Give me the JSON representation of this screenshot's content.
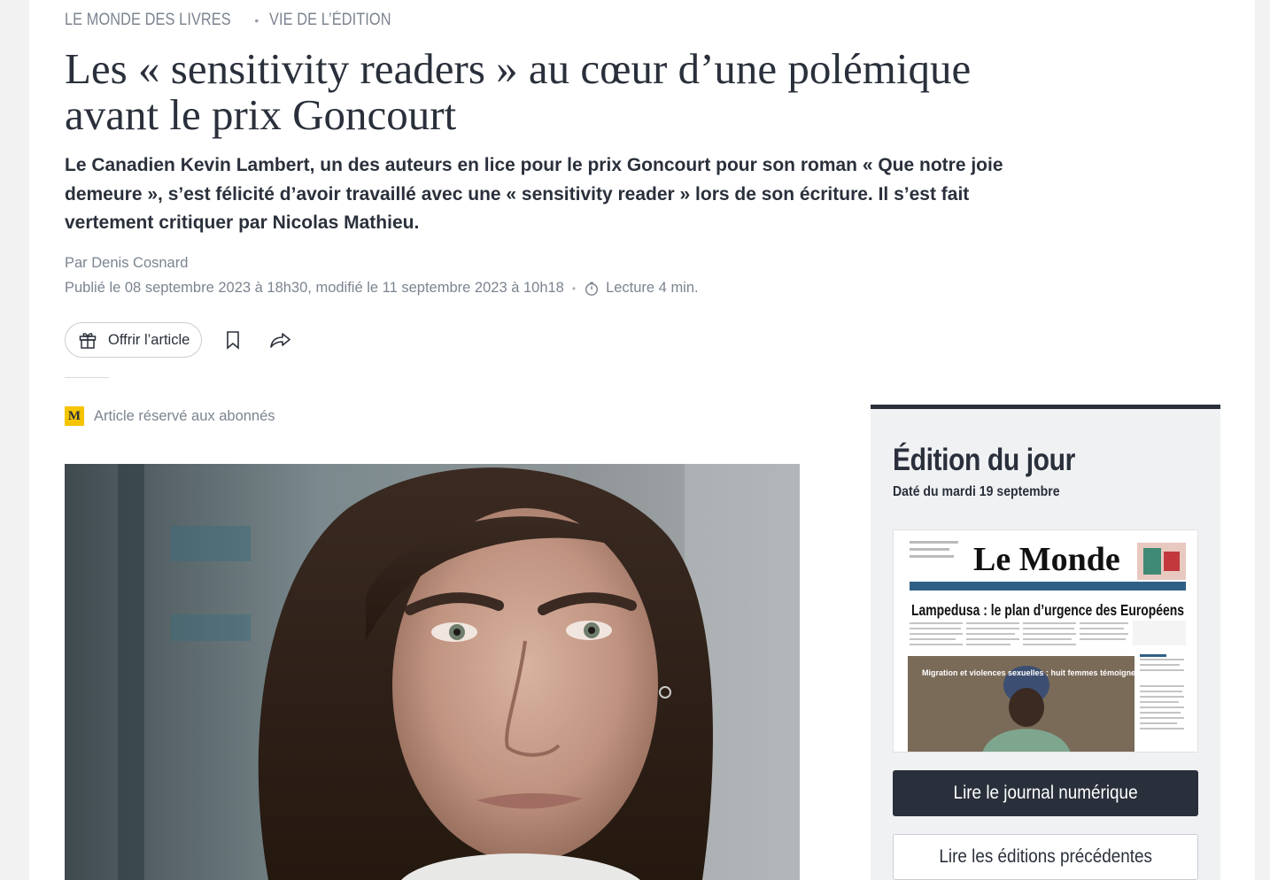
{
  "breadcrumb": {
    "section": "LE MONDE DES LIVRES",
    "subsection": "VIE DE L’ÉDITION"
  },
  "article": {
    "title": "Les « sensitivity readers » au cœur d’une polémique avant le prix Goncourt",
    "standfirst": "Le Canadien Kevin Lambert, un des auteurs en lice pour le prix Goncourt pour son roman « Que notre joie demeure », s’est félicité d’avoir travaillé avec une « sensitivity reader » lors de son écriture. Il s’est fait vertement critiquer par Nicolas Mathieu.",
    "author": "Par Denis Cosnard",
    "published": "Publié le 08 septembre 2023 à 18h30, modifié le 11 septembre 2023 à 10h18",
    "reading_time": "Lecture 4 min.",
    "premium_label": "Article réservé aux abonnés",
    "premium_badge": "M"
  },
  "actions": {
    "offer_label": "Offrir l’article",
    "icons": [
      "gift-icon",
      "bookmark-icon",
      "share-icon",
      "timer-icon"
    ]
  },
  "sidebar": {
    "title": "Édition du jour",
    "date": "Daté du mardi 19 septembre",
    "read_button": "Lire le journal numérique",
    "previous_button": "Lire les éditions précédentes",
    "cover": {
      "masthead": "Le Monde",
      "headline": "Lampedusa : le plan d’urgence des Européens",
      "photo_caption": "Migration et violences sexuelles : huit femmes témoignent"
    }
  },
  "colors": {
    "text": "#2a303b",
    "muted": "#7b8490",
    "premium": "#f5c400",
    "dark_button": "#2a303b"
  }
}
